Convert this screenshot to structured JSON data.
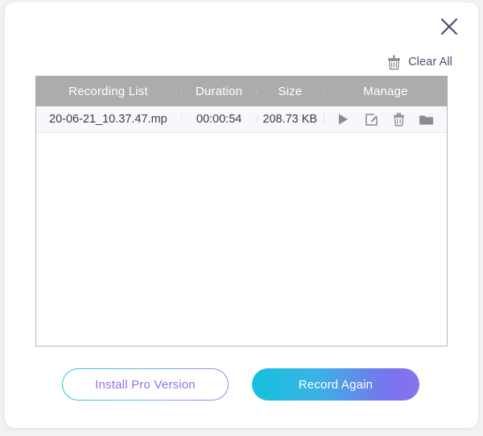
{
  "window": {
    "close_icon": "close-icon"
  },
  "toolbar": {
    "clear_all_label": "Clear All",
    "clear_all_icon": "trash-icon"
  },
  "table": {
    "columns": [
      {
        "label": "Recording List",
        "name": "recording-list"
      },
      {
        "label": "Duration",
        "name": "duration"
      },
      {
        "label": "Size",
        "name": "size"
      },
      {
        "label": "Manage",
        "name": "manage"
      }
    ],
    "rows": [
      {
        "name": "20-06-21_10.37.47.mp",
        "duration": "00:00:54",
        "size": "208.73 KB",
        "actions": [
          "play-icon",
          "edit-icon",
          "delete-icon",
          "folder-icon"
        ]
      }
    ]
  },
  "footer": {
    "install_pro_label": "Install Pro Version",
    "record_again_label": "Record Again"
  },
  "colors": {
    "header_gray": "#acacac",
    "row_background": "#f7f8fc",
    "accent_cyan": "#15c0dd",
    "accent_purple": "#8a73ee",
    "close_icon": "#4a4e78",
    "text_dark": "#3b3b42"
  }
}
